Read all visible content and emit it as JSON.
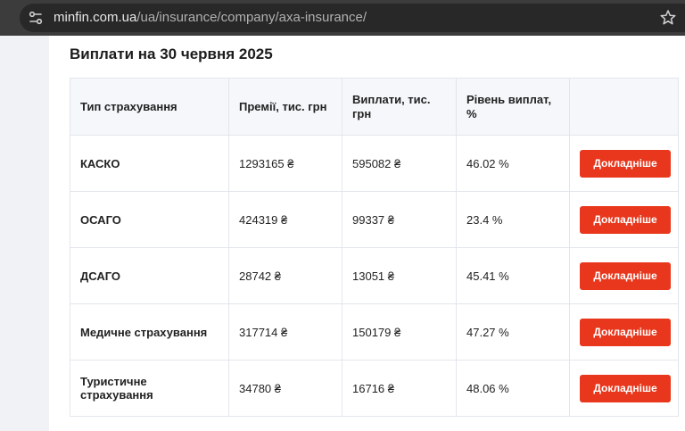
{
  "browser": {
    "url_domain": "minfin.com.ua",
    "url_path": "/ua/insurance/company/axa-insurance/"
  },
  "section": {
    "title": "Виплати на 30 червня 2025"
  },
  "table": {
    "headers": {
      "type": "Тип страхування",
      "premiums": "Премії, тис. грн",
      "payouts": "Виплати, тис. грн",
      "level": "Рівень виплат, %"
    },
    "rows": [
      {
        "type": "КАСКО",
        "premiums": "1293165 ₴",
        "payouts": "595082 ₴",
        "level": "46.02 %",
        "button": "Докладніше"
      },
      {
        "type": "ОСАГО",
        "premiums": "424319 ₴",
        "payouts": "99337 ₴",
        "level": "23.4 %",
        "button": "Докладніше"
      },
      {
        "type": "ДСАГО",
        "premiums": "28742 ₴",
        "payouts": "13051 ₴",
        "level": "45.41 %",
        "button": "Докладніше"
      },
      {
        "type": "Медичне страхування",
        "premiums": "317714 ₴",
        "payouts": "150179 ₴",
        "level": "47.27 %",
        "button": "Докладніше"
      },
      {
        "type": "Туристичне страхування",
        "premiums": "34780 ₴",
        "payouts": "16716 ₴",
        "level": "48.06 %",
        "button": "Докладніше"
      }
    ]
  },
  "colors": {
    "accent_button": "#e8371c",
    "link_blue": "#1f3c88"
  },
  "icons": {
    "site_info": "site-settings-icon",
    "bookmark": "star-icon"
  }
}
